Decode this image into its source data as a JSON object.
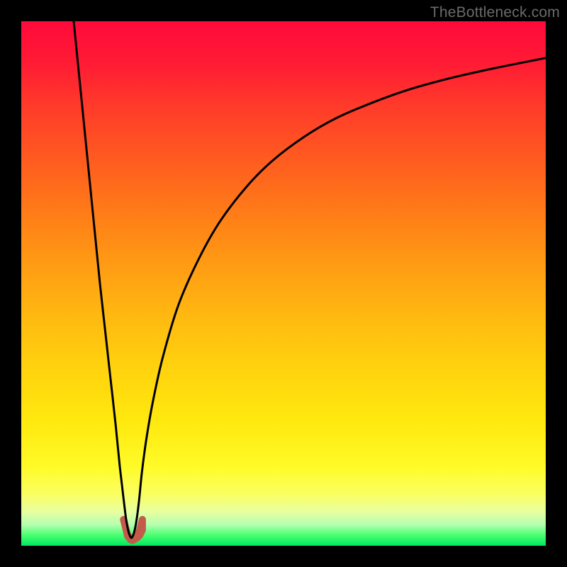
{
  "watermark": "TheBottleneck.com",
  "chart_data": {
    "type": "line",
    "title": "",
    "xlabel": "",
    "ylabel": "",
    "xlim": [
      0,
      100
    ],
    "ylim": [
      0,
      100
    ],
    "minimum_x_pct": 21,
    "series": [
      {
        "name": "bottleneck-curve",
        "x_pct": [
          10.0,
          11.0,
          12.0,
          13.0,
          14.0,
          15.0,
          16.0,
          17.0,
          18.0,
          18.8,
          19.5,
          20.0,
          20.5,
          21.0,
          21.5,
          22.0,
          22.5,
          23.0,
          23.8,
          25.0,
          27.0,
          30.0,
          34.0,
          38.0,
          43.0,
          48.0,
          54.0,
          60.0,
          67.0,
          74.0,
          82.0,
          90.0,
          100.0
        ],
        "y_pct": [
          100.0,
          90.0,
          80.0,
          70.0,
          60.0,
          50.0,
          41.0,
          32.0,
          23.0,
          15.0,
          9.0,
          5.0,
          2.5,
          1.5,
          2.5,
          5.0,
          9.0,
          14.0,
          20.0,
          27.0,
          36.0,
          46.0,
          55.0,
          62.0,
          68.5,
          73.5,
          78.0,
          81.5,
          84.5,
          87.0,
          89.2,
          91.0,
          93.0
        ]
      },
      {
        "name": "marker-blob",
        "x_pct": [
          19.5,
          20.0,
          20.3,
          20.8,
          21.2,
          21.6,
          22.1,
          22.6,
          23.1,
          23.1,
          22.6,
          22.1,
          21.6,
          21.2,
          20.8,
          20.3,
          20.0,
          19.5,
          19.5
        ],
        "y_pct": [
          5.0,
          3.0,
          1.8,
          1.2,
          1.0,
          1.2,
          1.8,
          3.0,
          5.0,
          3.0,
          2.0,
          1.5,
          1.3,
          1.3,
          1.5,
          2.0,
          3.0,
          5.0,
          5.0
        ]
      }
    ],
    "colors": {
      "curve": "#000000",
      "marker": "#c45a4a",
      "gradient_top": "#ff0a3b",
      "gradient_bottom": "#00e860",
      "frame": "#000000"
    }
  }
}
